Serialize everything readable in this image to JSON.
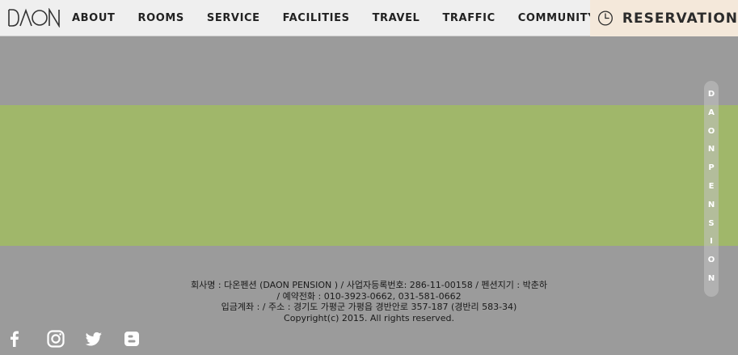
{
  "brand": {
    "logo_text": "DAON"
  },
  "nav": {
    "items": [
      {
        "label": "ABOUT"
      },
      {
        "label": "ROOMS"
      },
      {
        "label": "SERVICE"
      },
      {
        "label": "FACILITIES"
      },
      {
        "label": "TRAVEL"
      },
      {
        "label": "TRAFFIC"
      },
      {
        "label": "COMMUNITY"
      }
    ]
  },
  "reservation": {
    "label": "RESERVATION",
    "icon": "clock-icon"
  },
  "side_tab": {
    "letters": [
      "D",
      "A",
      "O",
      "N",
      "P",
      "E",
      "N",
      "S",
      "I",
      "O",
      "N"
    ]
  },
  "footer": {
    "lines": [
      "회사명 : 다온펜션 (DAON PENSION ) / 사업자등록번호: 286-11-00158 / 펜션지기 : 박춘하",
      "/ 예약전화 : 010-3923-0662, 031-581-0662",
      "입금계좌 : / 주소 : 경기도 가평군 가평읍 경반안로 357-187 (경반리 583-34)",
      "Copyright(c) 2015. All rights reserved."
    ]
  },
  "social": {
    "icons": [
      "facebook-icon",
      "instagram-icon",
      "twitter-icon",
      "blogger-icon"
    ]
  },
  "colors": {
    "page_background": "#9b9b9b",
    "navbar_background": "#efefef",
    "reservation_background": "#f4e8da",
    "green_band": "#a0b76a",
    "text_dark": "#222222",
    "white": "#ffffff"
  }
}
